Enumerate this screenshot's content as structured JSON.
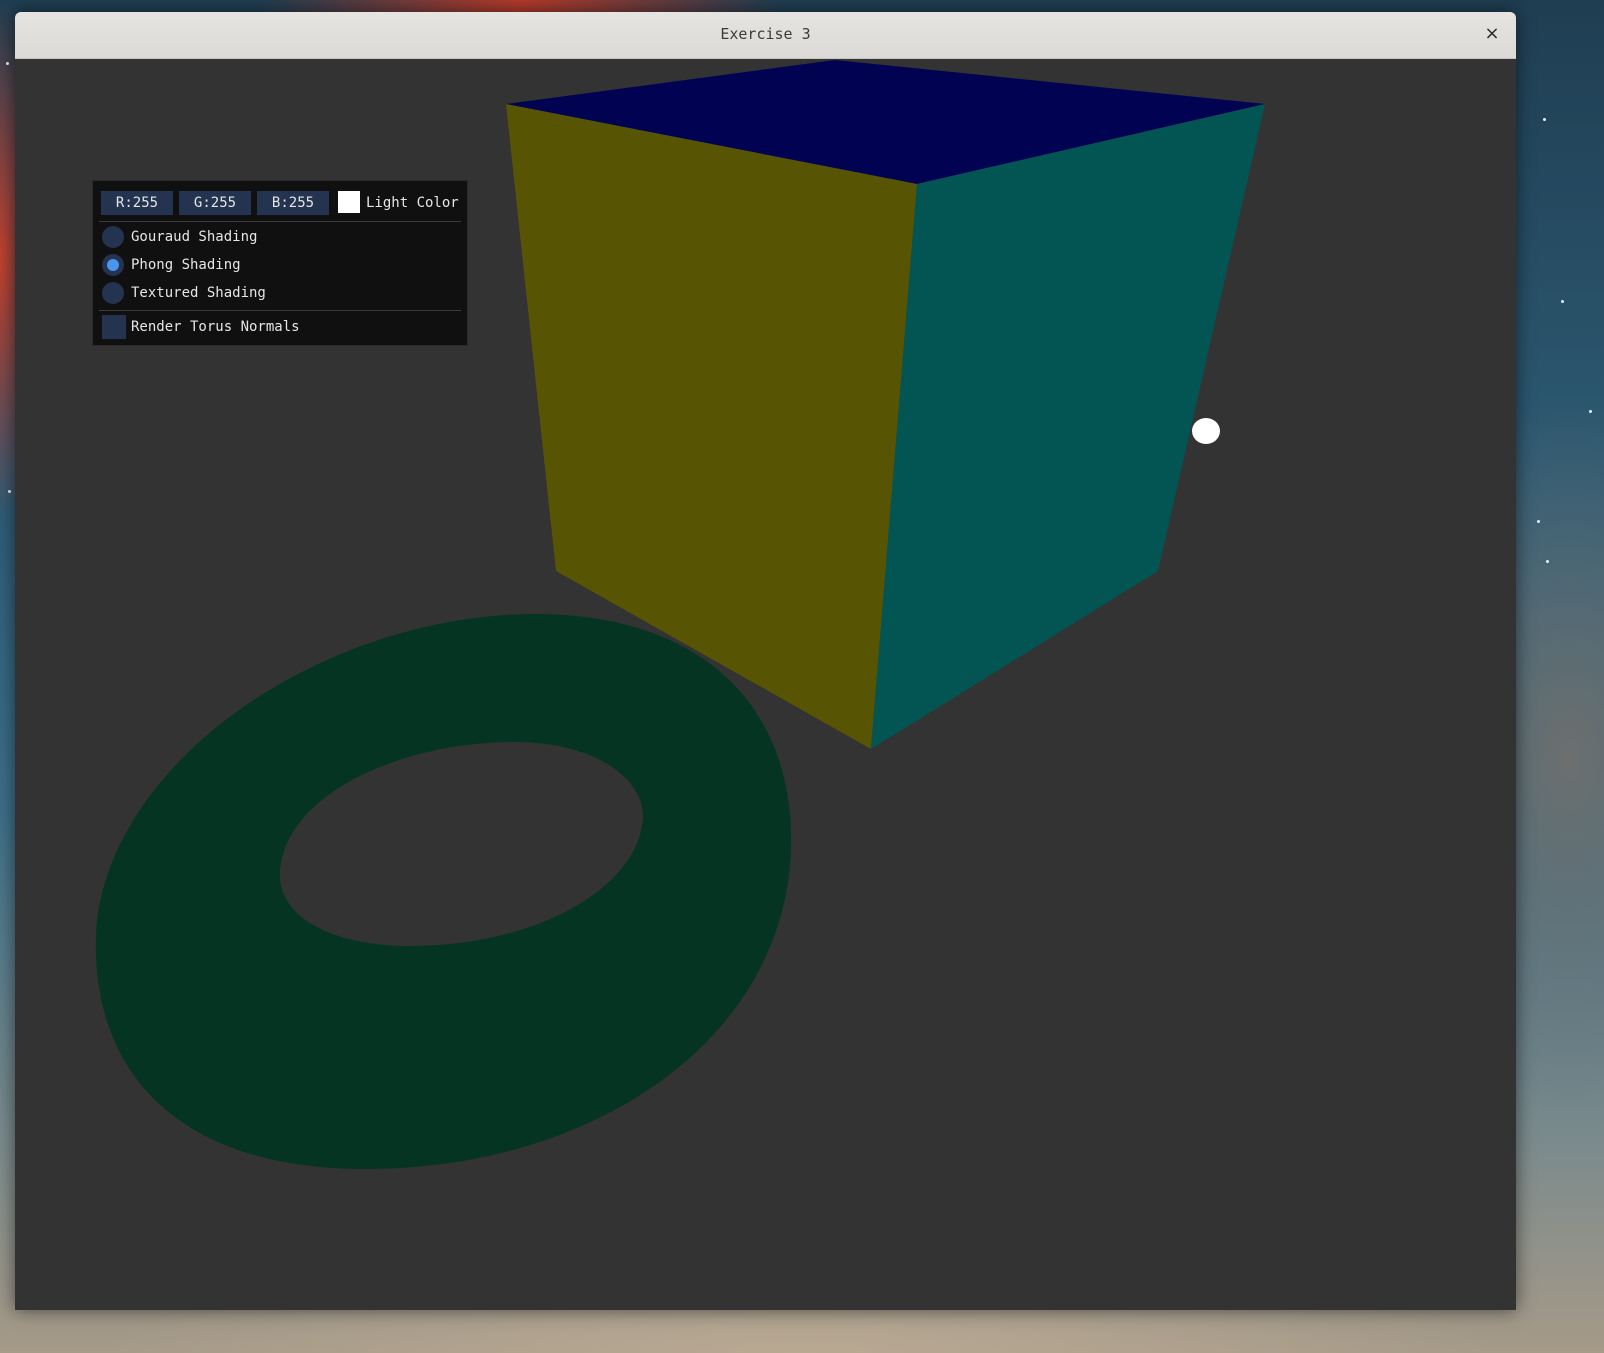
{
  "window": {
    "title": "Exercise 3",
    "close_glyph": "×"
  },
  "controls": {
    "rgb": {
      "r_label": "R:255",
      "g_label": "G:255",
      "b_label": "B:255"
    },
    "light_color_label": "Light Color",
    "light_color_hex": "#ffffff",
    "shading_options": [
      {
        "label": "Gouraud Shading",
        "selected": false
      },
      {
        "label": "Phong Shading",
        "selected": true
      },
      {
        "label": "Textured Shading",
        "selected": false
      }
    ],
    "render_torus_normals": {
      "label": "Render Torus Normals",
      "checked": false
    }
  },
  "scene": {
    "background_color": "#333333",
    "cube_faces": {
      "top_color": "#020253",
      "left_color": "#575503",
      "right_color": "#035554"
    },
    "torus_color": "#063422",
    "light_marker_color": "#ffffff"
  },
  "icons": {
    "close": "close-icon",
    "light": "light-source-icon"
  }
}
